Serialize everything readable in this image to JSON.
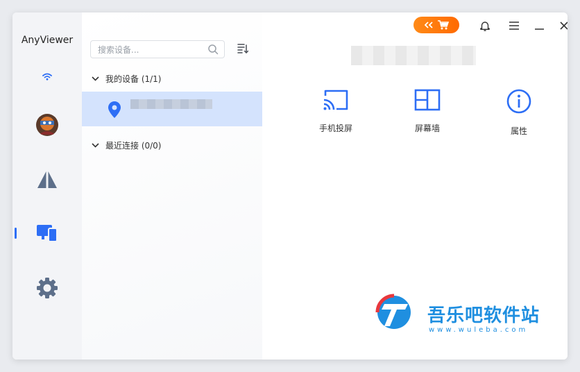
{
  "app": {
    "title": "AnyViewer"
  },
  "search": {
    "placeholder": "搜索设备..."
  },
  "groups": [
    {
      "label": "我的设备 (1/1)"
    },
    {
      "label": "最近连接 (0/0)"
    }
  ],
  "actions": [
    {
      "label": "手机投屏",
      "icon": "cast-icon"
    },
    {
      "label": "屏幕墙",
      "icon": "screen-wall-icon"
    },
    {
      "label": "属性",
      "icon": "info-icon"
    }
  ],
  "nav": {
    "active": "devices",
    "items": [
      "wifi-icon",
      "avatar",
      "remote-control-icon",
      "devices-icon",
      "settings-icon"
    ]
  },
  "watermark": {
    "text": "吾乐吧软件站",
    "url": "www.wuleba.com"
  },
  "colors": {
    "accent": "#2d6ef5",
    "nav_icon": "#5d6f8a",
    "selected_row": "#d4e3fd",
    "promo": "#ff7a10"
  }
}
